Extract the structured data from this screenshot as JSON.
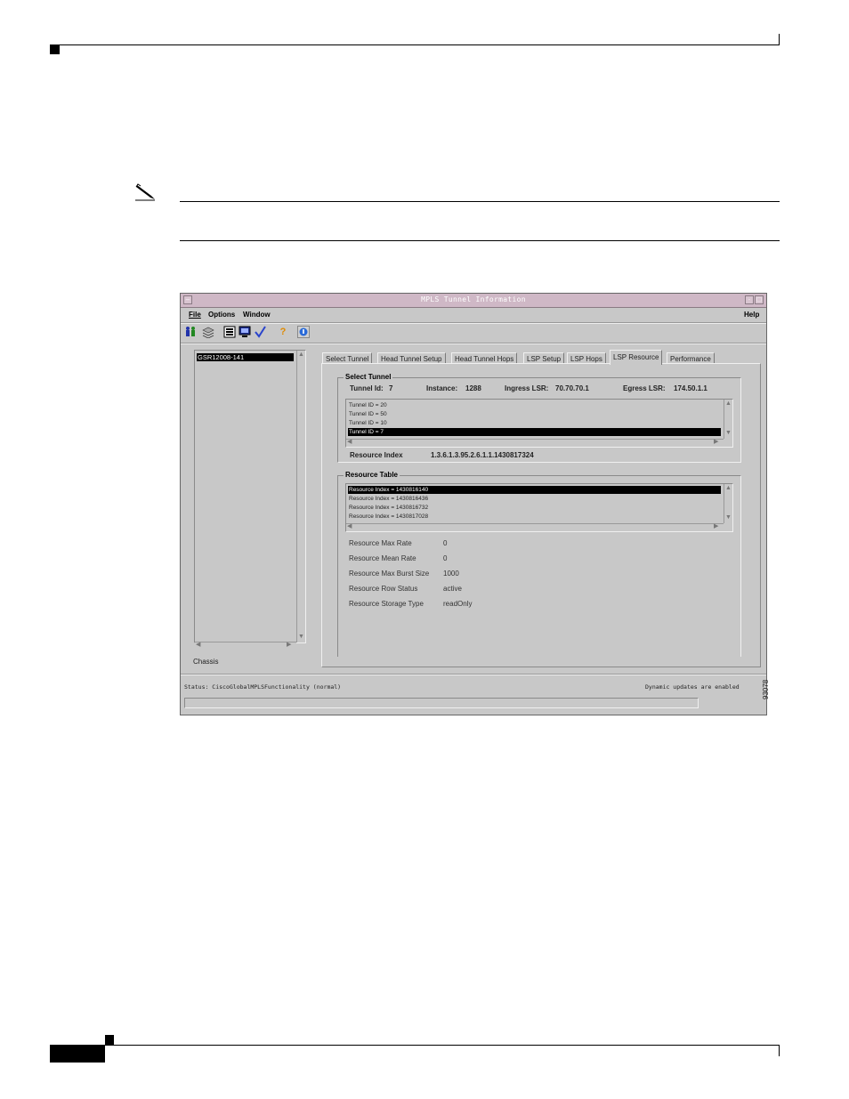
{
  "window": {
    "title": "MPLS Tunnel Information",
    "menus": {
      "file": "File",
      "options": "Options",
      "window": "Window",
      "help": "Help"
    },
    "toolbar_icons": [
      "users-icon",
      "layers-icon",
      "list-icon",
      "monitor-icon",
      "check-icon",
      "help-icon",
      "info-icon"
    ]
  },
  "tree": {
    "selected": "GSR12008-141",
    "footer": "Chassis"
  },
  "tabs": [
    "Select Tunnel",
    "Head Tunnel Setup",
    "Head Tunnel Hops",
    "LSP Setup",
    "LSP Hops",
    "LSP Resource",
    "Performance"
  ],
  "active_tab": "LSP Resource",
  "select_tunnel": {
    "legend": "Select Tunnel",
    "tunnel_id_label": "Tunnel Id:",
    "tunnel_id": "7",
    "instance_label": "Instance:",
    "instance": "1288",
    "ingress_label": "Ingress LSR:",
    "ingress": "70.70.70.1",
    "egress_label": "Egress LSR:",
    "egress": "174.50.1.1",
    "list": [
      "Tunnel ID = 20",
      "Tunnel ID = 50",
      "Tunnel ID = 10",
      "Tunnel ID = 7"
    ],
    "resource_index_label": "Resource Index",
    "resource_index": "1.3.6.1.3.95.2.6.1.1.1430817324"
  },
  "resource_table": {
    "legend": "Resource Table",
    "list": [
      "Resource Index = 1430816140",
      "Resource Index = 1430816436",
      "Resource Index = 1430816732",
      "Resource Index = 1430817028"
    ],
    "fields": [
      {
        "label": "Resource Max Rate",
        "value": "0"
      },
      {
        "label": "Resource Mean Rate",
        "value": "0"
      },
      {
        "label": "Resource Max Burst Size",
        "value": "1000"
      },
      {
        "label": "Resource Row Status",
        "value": "active"
      },
      {
        "label": "Resource Storage Type",
        "value": "readOnly"
      }
    ]
  },
  "status": {
    "left": "Status: CiscoGlobalMPLSFunctionality (normal)",
    "right": "Dynamic updates are enabled"
  },
  "figure_id": "93078"
}
